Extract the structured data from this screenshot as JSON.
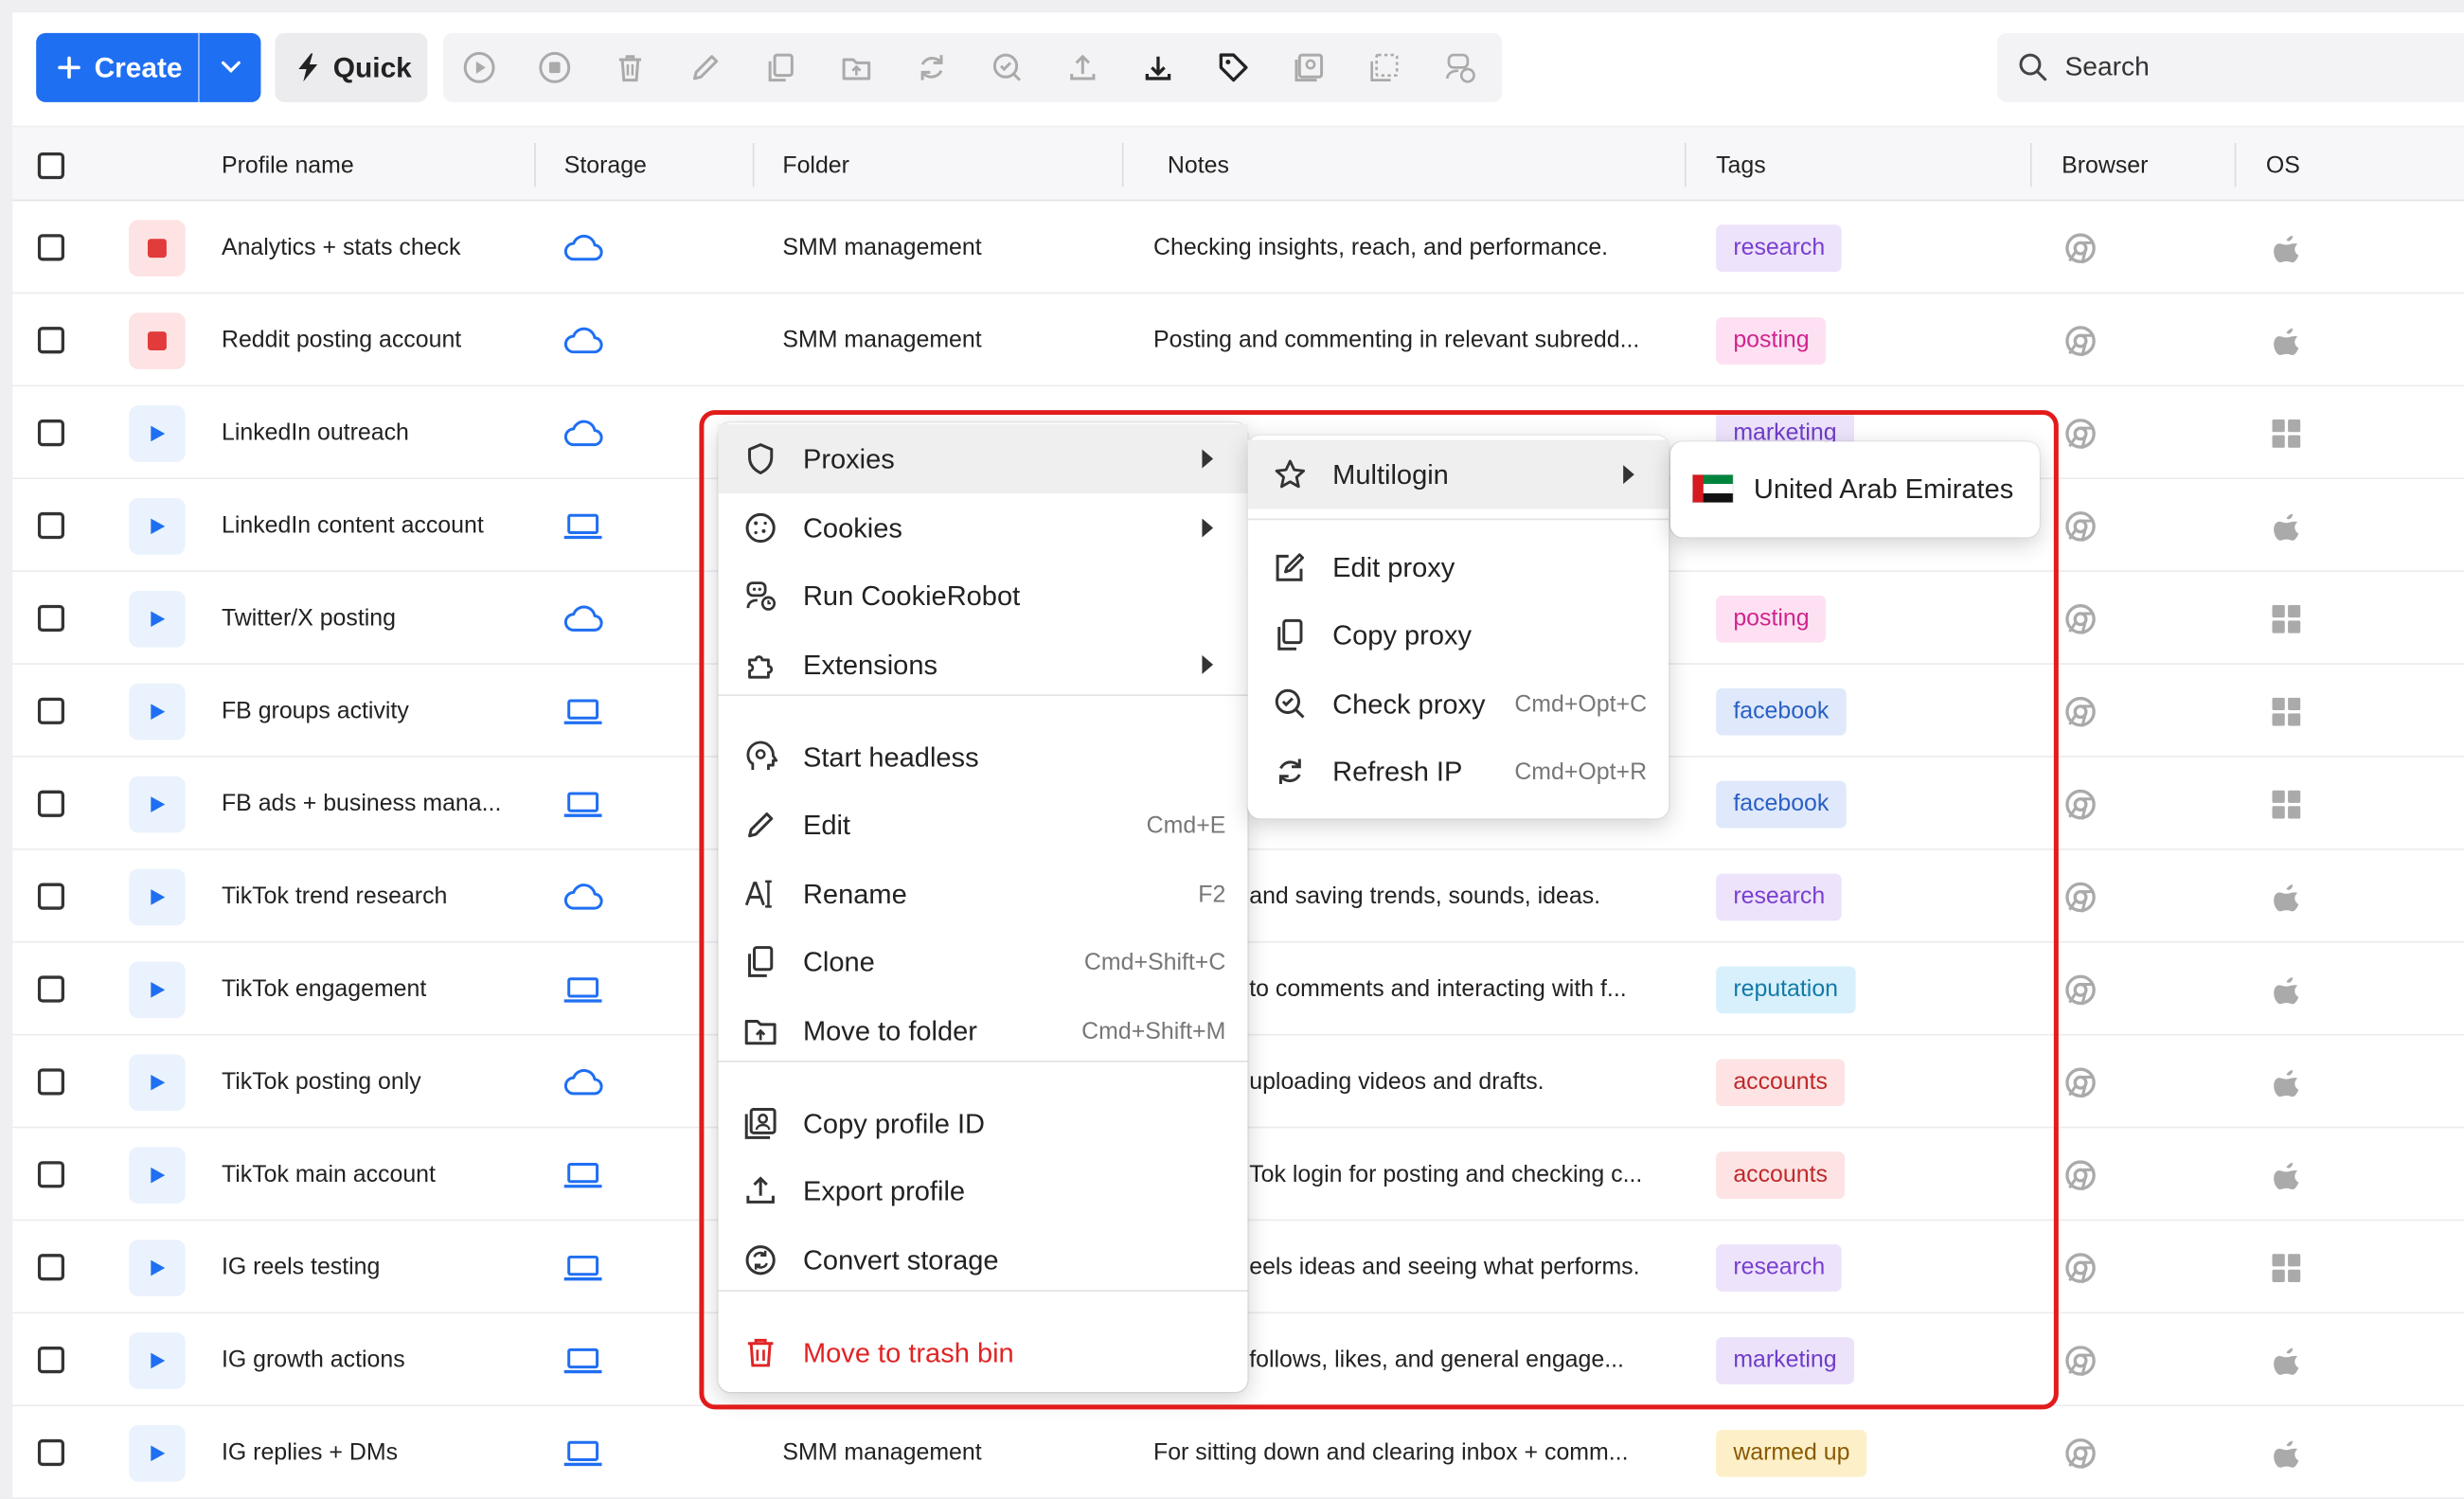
{
  "toolbar": {
    "create_label": "Create",
    "quick_label": "Quick",
    "search_placeholder": "Search"
  },
  "table": {
    "headers": {
      "profile_name": "Profile name",
      "storage": "Storage",
      "folder": "Folder",
      "notes": "Notes",
      "tags": "Tags",
      "browser": "Browser",
      "os": "OS"
    },
    "rows": [
      {
        "status": "stop",
        "name": "Analytics + stats check",
        "storage": "cloud",
        "folder": "SMM management",
        "notes": "Checking insights, reach, and performance.",
        "tag": "research",
        "os": "apple"
      },
      {
        "status": "stop",
        "name": "Reddit posting account",
        "storage": "cloud",
        "folder": "SMM management",
        "notes": "Posting and commenting in relevant subredd...",
        "tag": "posting",
        "os": "apple"
      },
      {
        "status": "play",
        "name": "LinkedIn outreach",
        "storage": "cloud",
        "folder": "",
        "notes": "",
        "tag": "marketing",
        "os": "windows"
      },
      {
        "status": "play",
        "name": "LinkedIn content account",
        "storage": "laptop",
        "folder": "",
        "notes": "",
        "tag": "",
        "os": "apple"
      },
      {
        "status": "play",
        "name": "Twitter/X posting",
        "storage": "cloud",
        "folder": "",
        "notes": "",
        "tag": "posting",
        "os": "windows"
      },
      {
        "status": "play",
        "name": "FB groups activity",
        "storage": "laptop",
        "folder": "",
        "notes": "",
        "tag": "facebook",
        "os": "windows"
      },
      {
        "status": "play",
        "name": "FB ads + business mana...",
        "storage": "laptop",
        "folder": "",
        "notes": "",
        "tag": "facebook",
        "os": "windows"
      },
      {
        "status": "play",
        "name": "TikTok trend research",
        "storage": "cloud",
        "folder": "",
        "notes": "and saving trends, sounds, ideas.",
        "tag": "research",
        "os": "apple"
      },
      {
        "status": "play",
        "name": "TikTok engagement",
        "storage": "laptop",
        "folder": "",
        "notes": "to comments and interacting with f...",
        "tag": "reputation",
        "os": "apple"
      },
      {
        "status": "play",
        "name": "TikTok posting only",
        "storage": "cloud",
        "folder": "",
        "notes": "uploading videos and drafts.",
        "tag": "accounts",
        "os": "apple"
      },
      {
        "status": "play",
        "name": "TikTok main account",
        "storage": "laptop",
        "folder": "",
        "notes": "Tok login for posting and checking c...",
        "tag": "accounts",
        "os": "apple"
      },
      {
        "status": "play",
        "name": "IG reels testing",
        "storage": "laptop",
        "folder": "",
        "notes": "eels ideas and seeing what performs.",
        "tag": "research",
        "os": "windows"
      },
      {
        "status": "play",
        "name": "IG growth actions",
        "storage": "laptop",
        "folder": "",
        "notes": "follows, likes, and general engage...",
        "tag": "marketing",
        "os": "apple"
      },
      {
        "status": "play",
        "name": "IG replies + DMs",
        "storage": "laptop",
        "folder": "SMM management",
        "notes": "For sitting down and clearing inbox + comm...",
        "tag": "warmed up",
        "os": "apple"
      }
    ]
  },
  "tag_colors": {
    "research": {
      "bg": "#ede3fb",
      "fg": "#7a3fd0"
    },
    "posting": {
      "bg": "#fde1f2",
      "fg": "#d0248f"
    },
    "marketing": {
      "bg": "#ece3fb",
      "fg": "#6f3cc8"
    },
    "facebook": {
      "bg": "#dfe9fb",
      "fg": "#2a5fc4"
    },
    "reputation": {
      "bg": "#d8f0fb",
      "fg": "#137aa8"
    },
    "accounts": {
      "bg": "#fde3e3",
      "fg": "#c0292b"
    },
    "warmed up": {
      "bg": "#fdf0c8",
      "fg": "#8a5a00"
    }
  },
  "context_menu": {
    "items": [
      {
        "icon": "shield-icon",
        "label": "Proxies",
        "submenu": true
      },
      {
        "icon": "cookie-icon",
        "label": "Cookies",
        "submenu": true
      },
      {
        "icon": "robot-icon",
        "label": "Run CookieRobot"
      },
      {
        "icon": "puzzle-icon",
        "label": "Extensions",
        "submenu": true
      },
      {
        "icon": "headless-icon",
        "label": "Start headless"
      },
      {
        "icon": "pencil-icon",
        "label": "Edit",
        "shortcut": "Cmd+E"
      },
      {
        "icon": "rename-icon",
        "label": "Rename",
        "shortcut": "F2"
      },
      {
        "icon": "clone-icon",
        "label": "Clone",
        "shortcut": "Cmd+Shift+C"
      },
      {
        "icon": "folder-move-icon",
        "label": "Move to folder",
        "shortcut": "Cmd+Shift+M"
      },
      {
        "icon": "id-card-icon",
        "label": "Copy profile ID"
      },
      {
        "icon": "export-icon",
        "label": "Export profile"
      },
      {
        "icon": "convert-icon",
        "label": "Convert storage"
      },
      {
        "icon": "trash-icon",
        "label": "Move to trash bin",
        "danger": true
      }
    ]
  },
  "proxy_submenu": {
    "items": [
      {
        "icon": "star-icon",
        "label": "Multilogin",
        "submenu": true
      },
      {
        "icon": "edit-proxy-icon",
        "label": "Edit proxy"
      },
      {
        "icon": "copy-icon",
        "label": "Copy proxy"
      },
      {
        "icon": "check-proxy-icon",
        "label": "Check proxy",
        "shortcut": "Cmd+Opt+C"
      },
      {
        "icon": "refresh-icon",
        "label": "Refresh IP",
        "shortcut": "Cmd+Opt+R"
      }
    ]
  },
  "country_submenu": {
    "label": "United Arab Emirates",
    "flag": "uae-flag-icon"
  },
  "colors": {
    "accent": "#1f6ff2",
    "danger": "#e02424",
    "highlight_box": "#e21b1b"
  }
}
